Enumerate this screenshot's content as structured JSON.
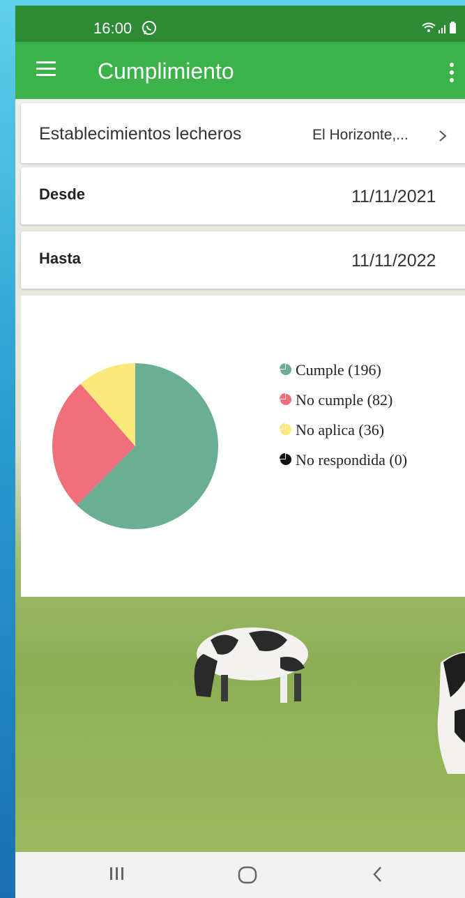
{
  "status_bar": {
    "time": "16:00"
  },
  "app_bar": {
    "title": "Cumplimiento"
  },
  "filters": {
    "establecimientos": {
      "label": "Establecimientos lecheros",
      "value": "El Horizonte,..."
    },
    "desde": {
      "label": "Desde",
      "value": "11/11/2021"
    },
    "hasta": {
      "label": "Hasta",
      "value": "11/11/2022"
    }
  },
  "colors": {
    "status_bar": "#2d8a35",
    "app_bar": "#3bb34a",
    "cumple": "#6aaf93",
    "no_cumple": "#f06f7a",
    "no_aplica": "#fbe97d",
    "no_respondida": "#111111"
  },
  "chart_data": {
    "type": "pie",
    "slices": [
      {
        "label": "Cumple",
        "value": 196,
        "color": "#6aaf93"
      },
      {
        "label": "No cumple",
        "value": 82,
        "color": "#f06f7a"
      },
      {
        "label": "No aplica",
        "value": 36,
        "color": "#fbe97d"
      },
      {
        "label": "No respondida",
        "value": 0,
        "color": "#111111"
      }
    ],
    "legend_labels": [
      "Cumple (196)",
      "No cumple (82)",
      "No aplica (36)",
      "No respondida (0)"
    ],
    "legend_position": "right"
  },
  "nav_bar": {
    "icons": [
      "recent-apps-icon",
      "home-icon",
      "back-icon"
    ]
  }
}
